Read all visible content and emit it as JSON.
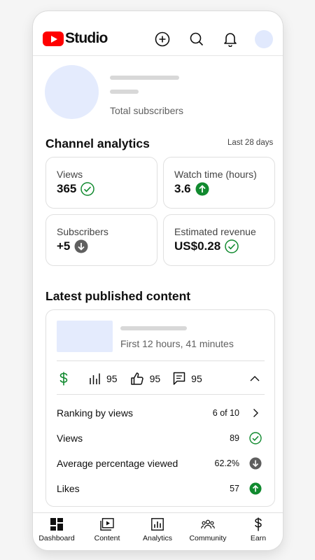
{
  "header": {
    "app_name": "Studio",
    "icons": [
      "create-icon",
      "search-icon",
      "notifications-icon",
      "account-avatar"
    ]
  },
  "channel": {
    "subscribers_label": "Total subscribers"
  },
  "analytics": {
    "title": "Channel analytics",
    "period": "Last 28 days",
    "cards": [
      {
        "label": "Views",
        "value": "365",
        "status": "check"
      },
      {
        "label": "Watch time (hours)",
        "value": "3.6",
        "status": "up"
      },
      {
        "label": "Subscribers",
        "value": "+5",
        "status": "down"
      },
      {
        "label": "Estimated revenue",
        "value": "US$0.28",
        "status": "check"
      }
    ]
  },
  "latest": {
    "title": "Latest published content",
    "duration": "First 12 hours, 41 minutes",
    "stats": [
      {
        "icon": "views-bars-icon",
        "value": "95"
      },
      {
        "icon": "thumbs-up-icon",
        "value": "95"
      },
      {
        "icon": "comments-icon",
        "value": "95"
      }
    ],
    "metrics": [
      {
        "label": "Ranking by views",
        "value": "6 of 10",
        "icon": "chevron-right"
      },
      {
        "label": "Views",
        "value": "89",
        "icon": "check"
      },
      {
        "label": "Average percentage viewed",
        "value": "62.2%",
        "icon": "down"
      },
      {
        "label": "Likes",
        "value": "57",
        "icon": "up"
      }
    ]
  },
  "nav": {
    "items": [
      "Dashboard",
      "Content",
      "Analytics",
      "Community",
      "Earn"
    ]
  },
  "colors": {
    "brand_red": "#ff0000",
    "success_green": "#118a2f",
    "neutral_grey": "#606060",
    "avatar_placeholder": "#e4ebfd"
  }
}
